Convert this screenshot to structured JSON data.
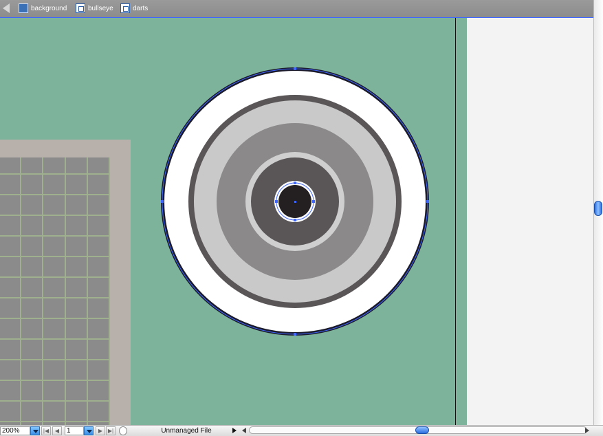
{
  "breadcrumb": {
    "items": [
      {
        "label": "background",
        "icon": "scene-icon"
      },
      {
        "label": "bullseye",
        "icon": "symbol-icon"
      },
      {
        "label": "darts",
        "icon": "symbol-icon"
      }
    ]
  },
  "statusbar": {
    "zoom": "200%",
    "page": "1",
    "status": "Unmanaged File"
  },
  "colors": {
    "stage": "#7db39b",
    "panel": "#b8b0aa",
    "grid_cell": "#8b8b8b",
    "grid_line": "#9fb08e",
    "selection": "#3f66ff"
  }
}
